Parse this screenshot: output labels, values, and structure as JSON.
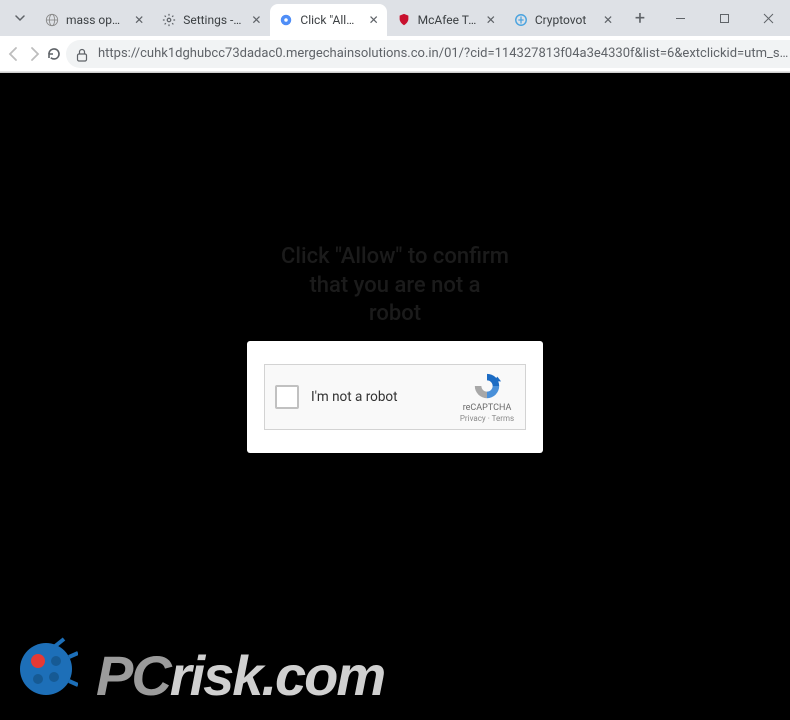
{
  "tabs": [
    {
      "title": "mass opener"
    },
    {
      "title": "Settings - Notif"
    },
    {
      "title": "Click \"Allow\""
    },
    {
      "title": "McAfee Total S"
    },
    {
      "title": "Cryptovot"
    }
  ],
  "url": "https://cuhk1dghubcc73dadac0.mergechainsolutions.co.in/01/?cid=114327813f04a3e4330f&list=6&extclickid=utm_s…",
  "page": {
    "hint": "Click \"Allow\" to confirm\nthat you are not a\nrobot",
    "captcha": {
      "label": "I'm not a robot",
      "brand": "reCAPTCHA",
      "legal": "Privacy · Terms"
    }
  },
  "watermark": {
    "prefix": "PC",
    "suffix": "risk.com"
  }
}
